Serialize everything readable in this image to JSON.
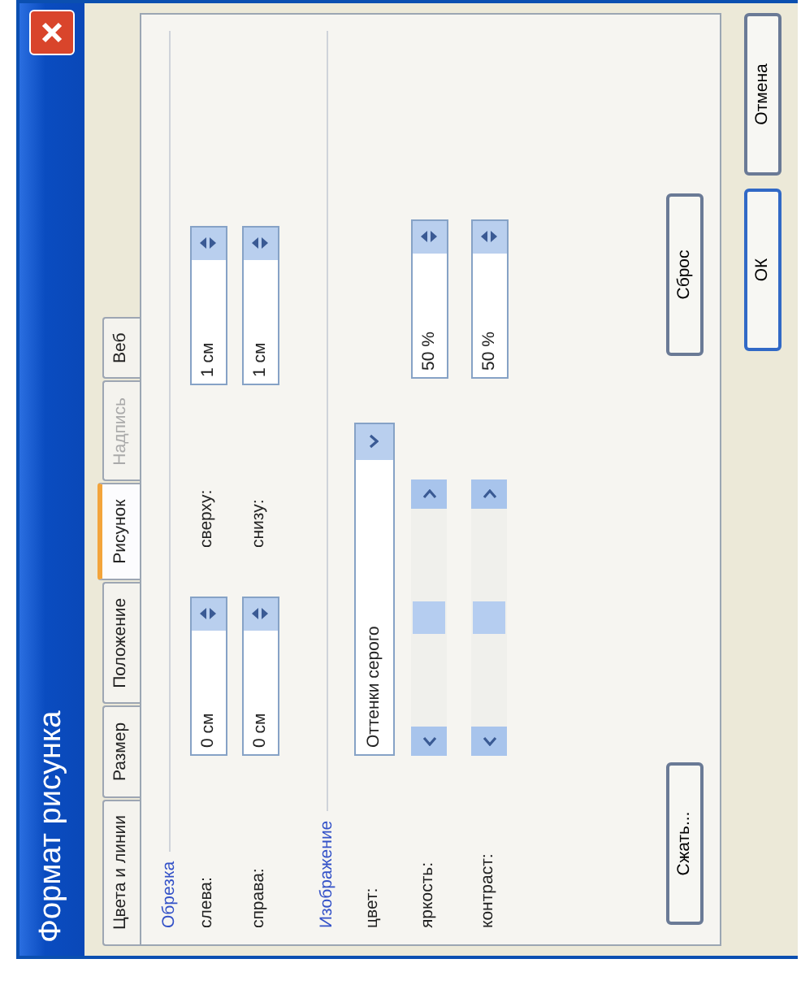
{
  "window": {
    "title": "Формат рисунка"
  },
  "tabs": [
    {
      "label": "Цвета и линии",
      "selected": false,
      "disabled": false
    },
    {
      "label": "Размер",
      "selected": false,
      "disabled": false
    },
    {
      "label": "Положение",
      "selected": false,
      "disabled": false
    },
    {
      "label": "Рисунок",
      "selected": true,
      "disabled": false
    },
    {
      "label": "Надпись",
      "selected": false,
      "disabled": true
    },
    {
      "label": "Веб",
      "selected": false,
      "disabled": false
    }
  ],
  "crop": {
    "title": "Обрезка",
    "fields": [
      {
        "label": "слева:",
        "value": "0 см"
      },
      {
        "label": "сверху:",
        "value": "1 см"
      },
      {
        "label": "справа:",
        "value": "0 см"
      },
      {
        "label": "снизу:",
        "value": "1 см"
      }
    ]
  },
  "image": {
    "title": "Изображение",
    "color": {
      "label": "цвет:",
      "value": "Оттенки серого"
    },
    "adjustments": [
      {
        "label": "яркость:",
        "level": 0.5,
        "value": "50 %"
      },
      {
        "label": "контраст:",
        "level": 0.5,
        "value": "50 %"
      }
    ],
    "compress_button": "Сжать...",
    "reset_button": "Сброс"
  },
  "buttons": [
    {
      "label": "ОК",
      "default": true
    },
    {
      "label": "Отмена",
      "default": false
    }
  ]
}
